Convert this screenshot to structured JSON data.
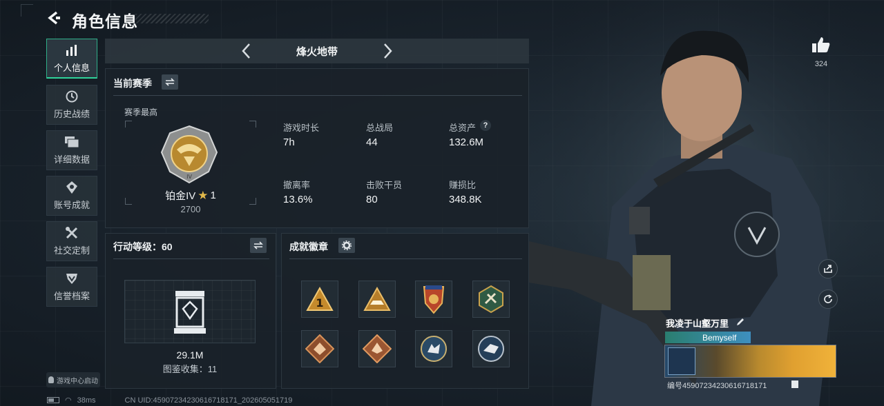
{
  "header": {
    "title": "角色信息"
  },
  "sidebar": {
    "items": [
      {
        "label": "个人信息",
        "icon": "bar-chart-icon",
        "active": true
      },
      {
        "label": "历史战绩",
        "icon": "clock-icon"
      },
      {
        "label": "详细数据",
        "icon": "folder-icon"
      },
      {
        "label": "账号成就",
        "icon": "badge-icon"
      },
      {
        "label": "社交定制",
        "icon": "tools-icon"
      },
      {
        "label": "信誉档案",
        "icon": "shield-icon"
      }
    ],
    "game_center": "游戏中心启动"
  },
  "mode": {
    "title": "烽火地带"
  },
  "season": {
    "title": "当前赛季",
    "best_label": "赛季最高",
    "rank_name": "铂金IV",
    "rank_stars": "1",
    "rank_score": "2700",
    "stats": [
      {
        "label": "游戏时长",
        "value": "7h"
      },
      {
        "label": "总战局",
        "value": "44"
      },
      {
        "label": "总资产",
        "value": "132.6M"
      },
      {
        "label": "撤离率",
        "value": "13.6%"
      },
      {
        "label": "击败干员",
        "value": "80"
      },
      {
        "label": "赚损比",
        "value": "348.8K"
      }
    ]
  },
  "action_level": {
    "title": "行动等级：60",
    "value": "29.1M",
    "collection": "图鉴收集：11"
  },
  "achievements": {
    "title": "成就徽章",
    "badges": [
      "badge-1-icon",
      "badge-ship-icon",
      "badge-crest-icon",
      "badge-hex-icon",
      "badge-beast-icon",
      "badge-beast2-icon",
      "badge-wolf-icon",
      "badge-wolf2-icon"
    ]
  },
  "profile": {
    "likes": "324",
    "name": "我凌于山壑万里",
    "tag": "Bemyself",
    "uid": "编号4590723423061671817​1"
  },
  "footer": {
    "ping": "38ms",
    "cn_uid": "CN UID:459072342306167181​71_202605051719"
  },
  "colors": {
    "accent": "#2fd39a",
    "panel": "#1a2229",
    "gold": "#d9a441"
  }
}
